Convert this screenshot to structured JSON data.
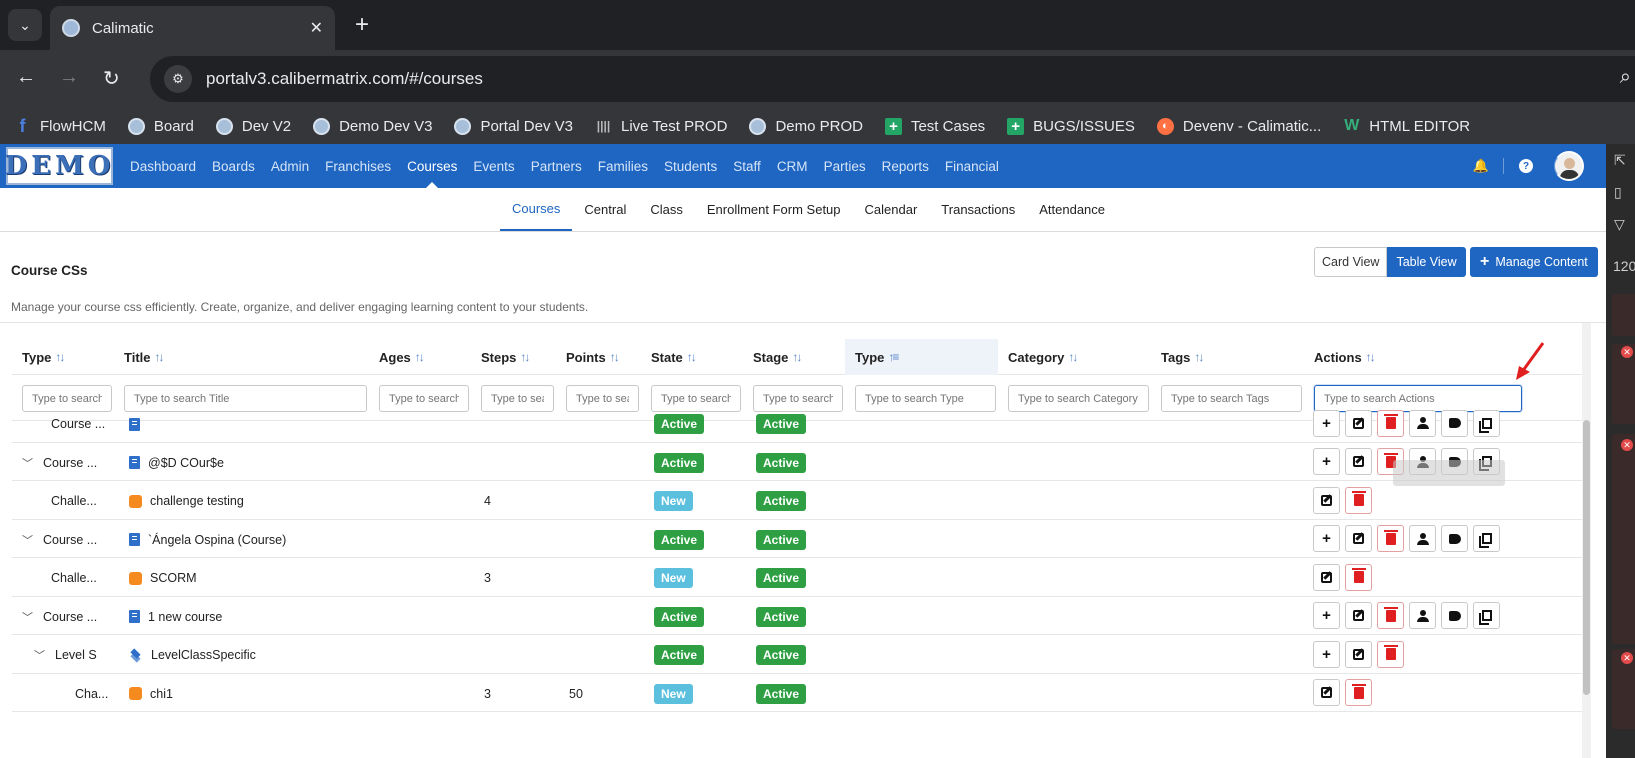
{
  "browser": {
    "tab_title": "Calimatic",
    "url": "portalv3.calibermatrix.com/#/courses",
    "bookmarks": [
      {
        "label": "FlowHCM",
        "icon": "f-icon"
      },
      {
        "label": "Board",
        "icon": "globe-icon"
      },
      {
        "label": "Dev V2",
        "icon": "globe-icon"
      },
      {
        "label": "Demo Dev V3",
        "icon": "globe-icon"
      },
      {
        "label": "Portal Dev V3",
        "icon": "globe-icon"
      },
      {
        "label": "Live Test PROD",
        "icon": "wave-icon"
      },
      {
        "label": "Demo PROD",
        "icon": "globe-icon"
      },
      {
        "label": "Test Cases",
        "icon": "sheets-icon"
      },
      {
        "label": "BUGS/ISSUES",
        "icon": "sheets-icon"
      },
      {
        "label": "Devenv - Calimatic...",
        "icon": "devenv-icon"
      },
      {
        "label": "HTML EDITOR",
        "icon": "w-icon"
      }
    ]
  },
  "app": {
    "logo_text": "DEMO",
    "main_nav": [
      "Dashboard",
      "Boards",
      "Admin",
      "Franchises",
      "Courses",
      "Events",
      "Partners",
      "Families",
      "Students",
      "Staff",
      "CRM",
      "Parties",
      "Reports",
      "Financial"
    ],
    "main_nav_active": "Courses",
    "sub_nav": [
      "Courses",
      "Central",
      "Class",
      "Enrollment Form Setup",
      "Calendar",
      "Transactions",
      "Attendance"
    ],
    "sub_nav_active": "Courses"
  },
  "page": {
    "title": "Course CSs",
    "description": "Manage your course css efficiently. Create, organize, and deliver engaging learning content to your students.",
    "card_view": "Card View",
    "table_view": "Table View",
    "manage_content": "Manage Content"
  },
  "table": {
    "columns": [
      {
        "label": "Type",
        "placeholder": "Type to search Type"
      },
      {
        "label": "Title",
        "placeholder": "Type to search Title"
      },
      {
        "label": "Ages",
        "placeholder": "Type to search Ages"
      },
      {
        "label": "Steps",
        "placeholder": "Type to search Steps"
      },
      {
        "label": "Points",
        "placeholder": "Type to search Points"
      },
      {
        "label": "State",
        "placeholder": "Type to search State"
      },
      {
        "label": "Stage",
        "placeholder": "Type to search Stage"
      },
      {
        "label": "Type",
        "placeholder": "Type to search Type"
      },
      {
        "label": "Category",
        "placeholder": "Type to search Category"
      },
      {
        "label": "Tags",
        "placeholder": "Type to search Tags"
      },
      {
        "label": "Actions",
        "placeholder": "Type to search Actions"
      }
    ],
    "rows": [
      {
        "type": "Course ...",
        "title": "",
        "icon": "book-icon",
        "expand": false,
        "indent": 0,
        "steps": "",
        "points": "",
        "state": "Active",
        "stage": "Active",
        "actions": "full"
      },
      {
        "type": "Course ...",
        "title": "@$D COur$e",
        "icon": "book-icon",
        "expand": true,
        "indent": 0,
        "steps": "",
        "points": "",
        "state": "Active",
        "stage": "Active",
        "actions": "full"
      },
      {
        "type": "Challe...",
        "title": "challenge testing",
        "icon": "puzzle-icon",
        "expand": false,
        "indent": 0,
        "steps": "4",
        "points": "",
        "state": "New",
        "stage": "Active",
        "actions": "short"
      },
      {
        "type": "Course ...",
        "title": "`Ángela Ospina (Course)",
        "icon": "book-icon",
        "expand": true,
        "indent": 0,
        "steps": "",
        "points": "",
        "state": "Active",
        "stage": "Active",
        "actions": "full"
      },
      {
        "type": "Challe...",
        "title": "SCORM",
        "icon": "puzzle-icon",
        "expand": false,
        "indent": 0,
        "steps": "3",
        "points": "",
        "state": "New",
        "stage": "Active",
        "actions": "short"
      },
      {
        "type": "Course ...",
        "title": "1 new course",
        "icon": "book-icon",
        "expand": true,
        "indent": 0,
        "steps": "",
        "points": "",
        "state": "Active",
        "stage": "Active",
        "actions": "full"
      },
      {
        "type": "Level S",
        "title": "LevelClassSpecific",
        "icon": "layers-icon",
        "expand": true,
        "indent": 1,
        "steps": "",
        "points": "",
        "state": "Active",
        "stage": "Active",
        "actions": "level"
      },
      {
        "type": "Cha...",
        "title": "chi1",
        "icon": "puzzle-icon",
        "expand": false,
        "indent": 2,
        "steps": "3",
        "points": "50",
        "state": "New",
        "stage": "Active",
        "actions": "short"
      }
    ]
  },
  "devtools": {
    "zoom_label": "120"
  },
  "colors": {
    "brand": "#1e66c2",
    "active_badge": "#2ea043",
    "new_badge": "#5bc0de",
    "delete": "#e02020"
  }
}
